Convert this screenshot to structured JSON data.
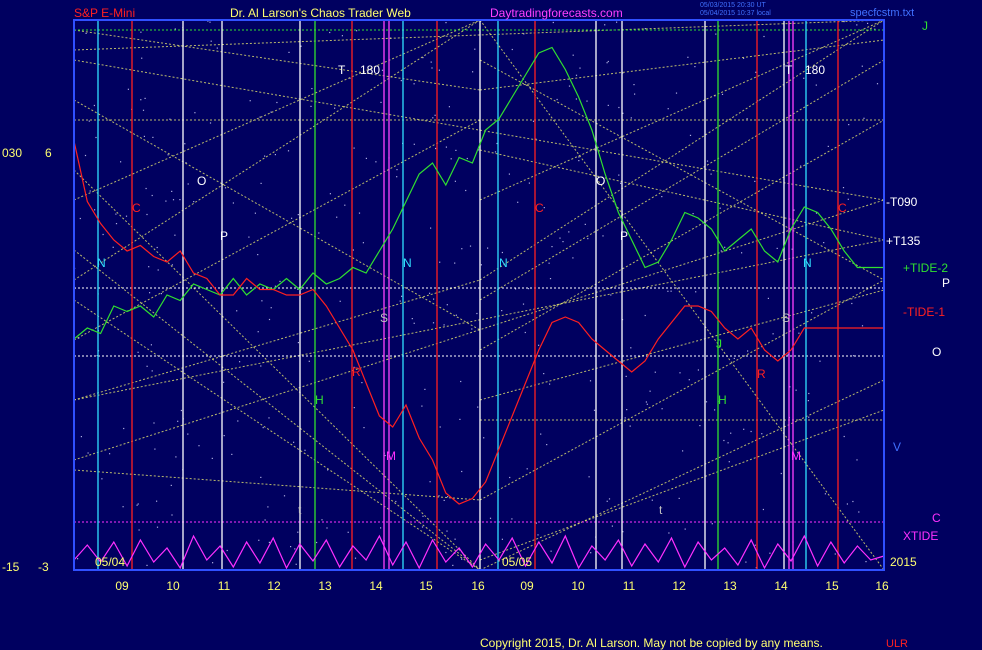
{
  "header": {
    "left_title": "S&P E-Mini",
    "center_title": "Dr. Al Larson's Chaos Trader Web",
    "site": "Daytradingforecasts.com",
    "stamp_line1": "05/03/2015 20:30 UT",
    "stamp_line2": "05/04/2015 10:37 local",
    "file": "specfcstm.txt"
  },
  "footer": {
    "copyright": "Copyright 2015, Dr. Al Larson. May not be copied by any means.",
    "mark": "ULR"
  },
  "colors": {
    "background": "#000060",
    "frame": "#3050ff",
    "tide1": "#ff2020",
    "tide2": "#30e030",
    "xtide": "#ff30ff",
    "gann_lines": "#e8e870",
    "dotted_levels": "#ffffff",
    "vline_white": "#ffffff",
    "vline_cyan": "#30e0ff",
    "vline_red": "#ff2020",
    "vline_green": "#30e030",
    "vline_magenta": "#ff40ff"
  },
  "chart_data": {
    "type": "line",
    "left_scale_top": [
      "030",
      "6"
    ],
    "left_scale_bottom": [
      "-15",
      "-3"
    ],
    "date_labels": [
      "05/04",
      "05/05"
    ],
    "year_label": "2015",
    "x_ticks": [
      "09",
      "10",
      "11",
      "12",
      "13",
      "14",
      "15",
      "16",
      "09",
      "10",
      "11",
      "12",
      "13",
      "14",
      "15",
      "16"
    ],
    "right_labels": [
      "J",
      "-T090",
      "+T135",
      "+TIDE-2",
      "P",
      "-TIDE-1",
      "O",
      "V",
      "C",
      "XTIDE"
    ],
    "annotations": [
      "T",
      "180",
      "T",
      "180",
      "O",
      "P",
      "C",
      "N",
      "N",
      "S",
      "H",
      "R",
      "M",
      "t",
      "N",
      "C",
      "O",
      "P",
      "N",
      "H",
      "R",
      "S",
      "M",
      "t",
      "C",
      "J"
    ],
    "series": [
      {
        "name": "+TIDE-2",
        "values": [
          0.58,
          0.56,
          0.57,
          0.52,
          0.53,
          0.52,
          0.54,
          0.5,
          0.51,
          0.48,
          0.49,
          0.5,
          0.47,
          0.5,
          0.48,
          0.49,
          0.47,
          0.49,
          0.46,
          0.48,
          0.47,
          0.45,
          0.46,
          0.42,
          0.38,
          0.33,
          0.28,
          0.26,
          0.3,
          0.25,
          0.26,
          0.2,
          0.18,
          0.14,
          0.1,
          0.06,
          0.05,
          0.09,
          0.14,
          0.2,
          0.28,
          0.35,
          0.4,
          0.45,
          0.44,
          0.4,
          0.35,
          0.36,
          0.38,
          0.42,
          0.4,
          0.38,
          0.42,
          0.44,
          0.38,
          0.34,
          0.35,
          0.38,
          0.42,
          0.45,
          0.45,
          0.45
        ]
      },
      {
        "name": "-TIDE-1",
        "values": [
          0.22,
          0.33,
          0.37,
          0.4,
          0.42,
          0.41,
          0.43,
          0.44,
          0.42,
          0.46,
          0.47,
          0.5,
          0.5,
          0.47,
          0.49,
          0.49,
          0.5,
          0.5,
          0.49,
          0.52,
          0.56,
          0.6,
          0.66,
          0.72,
          0.74,
          0.7,
          0.76,
          0.8,
          0.86,
          0.88,
          0.87,
          0.84,
          0.78,
          0.72,
          0.66,
          0.6,
          0.55,
          0.54,
          0.55,
          0.58,
          0.6,
          0.62,
          0.64,
          0.62,
          0.58,
          0.55,
          0.52,
          0.52,
          0.53,
          0.56,
          0.58,
          0.56,
          0.6,
          0.62,
          0.6,
          0.56,
          0.56,
          0.56,
          0.56,
          0.56,
          0.56,
          0.56
        ]
      },
      {
        "name": "XTIDE",
        "values": [
          0.9,
          0.75,
          0.92,
          0.72,
          0.96,
          0.7,
          0.92,
          0.78,
          0.98,
          0.66,
          0.9,
          0.76,
          0.97,
          0.72,
          0.93,
          0.68,
          0.98,
          0.74,
          0.91,
          0.7,
          0.97,
          0.76,
          0.9,
          0.66,
          0.95,
          0.72,
          0.98,
          0.7,
          0.92,
          0.78,
          0.97,
          0.74,
          0.9,
          0.68,
          0.96,
          0.72,
          0.93,
          0.66,
          0.98,
          0.76,
          0.9,
          0.7,
          0.96,
          0.74,
          0.92,
          0.68,
          0.97,
          0.72,
          0.9,
          0.78,
          0.95,
          0.7,
          0.98,
          0.74,
          0.91,
          0.66,
          0.96,
          0.72,
          0.93,
          0.76,
          0.9,
          0.86
        ]
      }
    ]
  }
}
